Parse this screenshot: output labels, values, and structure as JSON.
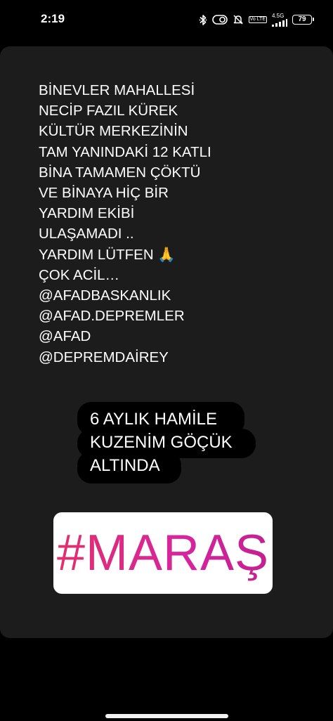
{
  "status_bar": {
    "time": "2:19",
    "network_top": "4.5G",
    "network_volte": "Vo LTE",
    "battery": "79",
    "icons": [
      "bluetooth-icon",
      "data-saver-icon",
      "mute-icon",
      "volte-icon",
      "signal-icon",
      "battery-icon"
    ]
  },
  "story": {
    "main_text_lines": [
      "BİNEVLER MAHALLESİ",
      "NECİP FAZIL KÜREK",
      "KÜLTÜR MERKEZİNİN",
      "TAM YANINDAKİ 12 KATLI",
      "BİNA TAMAMEN ÇÖKTÜ",
      "VE BİNAYA HİÇ BİR",
      "YARDIM EKİBİ",
      "ULAŞAMADI ..",
      "YARDIM LÜTFEN 🙏",
      "ÇOK ACİL…",
      "@AFADBASKANLIK",
      "@AFAD.DEPREMLER",
      "@AFAD",
      "@DEPREMDAİREY"
    ],
    "bubble_lines": [
      "6 AYLIK HAMİLE",
      "KUZENİM GÖÇÜK",
      "ALTINDA"
    ],
    "hashtag": "#MARAŞ"
  },
  "colors": {
    "background": "#000000",
    "card": "#1c1c1c",
    "hashtag": "#e1306c",
    "sticker_bg": "#ffffff"
  }
}
